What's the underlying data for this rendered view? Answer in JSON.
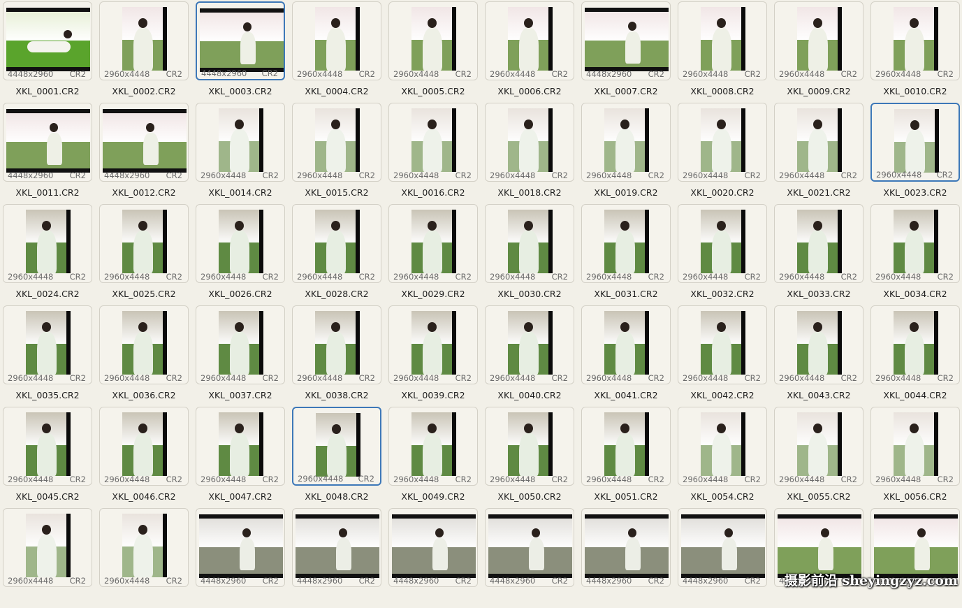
{
  "thumbnails": [
    {
      "name": "XKL_0001.CR2",
      "dims": "4448x2960",
      "format": "CR2",
      "orientation": "landscape",
      "scene": "grass",
      "selected": false
    },
    {
      "name": "XKL_0002.CR2",
      "dims": "2960x4448",
      "format": "CR2",
      "orientation": "portrait",
      "scene": "blossom",
      "selected": false
    },
    {
      "name": "XKL_0003.CR2",
      "dims": "4448x2960",
      "format": "CR2",
      "orientation": "landscape",
      "scene": "blossom",
      "selected": true
    },
    {
      "name": "XKL_0004.CR2",
      "dims": "2960x4448",
      "format": "CR2",
      "orientation": "portrait",
      "scene": "blossom",
      "selected": false
    },
    {
      "name": "XKL_0005.CR2",
      "dims": "2960x4448",
      "format": "CR2",
      "orientation": "portrait",
      "scene": "blossom",
      "selected": false
    },
    {
      "name": "XKL_0006.CR2",
      "dims": "2960x4448",
      "format": "CR2",
      "orientation": "portrait",
      "scene": "blossom",
      "selected": false
    },
    {
      "name": "XKL_0007.CR2",
      "dims": "4448x2960",
      "format": "CR2",
      "orientation": "landscape",
      "scene": "blossom",
      "selected": false
    },
    {
      "name": "XKL_0008.CR2",
      "dims": "2960x4448",
      "format": "CR2",
      "orientation": "portrait",
      "scene": "blossom",
      "selected": false
    },
    {
      "name": "XKL_0009.CR2",
      "dims": "2960x4448",
      "format": "CR2",
      "orientation": "portrait",
      "scene": "blossom",
      "selected": false
    },
    {
      "name": "XKL_0010.CR2",
      "dims": "2960x4448",
      "format": "CR2",
      "orientation": "portrait",
      "scene": "blossom",
      "selected": false
    },
    {
      "name": "XKL_0011.CR2",
      "dims": "4448x2960",
      "format": "CR2",
      "orientation": "landscape",
      "scene": "blossom",
      "selected": false
    },
    {
      "name": "XKL_0012.CR2",
      "dims": "4448x2960",
      "format": "CR2",
      "orientation": "landscape",
      "scene": "blossom",
      "selected": false
    },
    {
      "name": "XKL_0014.CR2",
      "dims": "2960x4448",
      "format": "CR2",
      "orientation": "portrait",
      "scene": "soft",
      "selected": false
    },
    {
      "name": "XKL_0015.CR2",
      "dims": "2960x4448",
      "format": "CR2",
      "orientation": "portrait",
      "scene": "soft",
      "selected": false
    },
    {
      "name": "XKL_0016.CR2",
      "dims": "2960x4448",
      "format": "CR2",
      "orientation": "portrait",
      "scene": "soft",
      "selected": false
    },
    {
      "name": "XKL_0018.CR2",
      "dims": "2960x4448",
      "format": "CR2",
      "orientation": "portrait",
      "scene": "soft",
      "selected": false
    },
    {
      "name": "XKL_0019.CR2",
      "dims": "2960x4448",
      "format": "CR2",
      "orientation": "portrait",
      "scene": "soft",
      "selected": false
    },
    {
      "name": "XKL_0020.CR2",
      "dims": "2960x4448",
      "format": "CR2",
      "orientation": "portrait",
      "scene": "soft",
      "selected": false
    },
    {
      "name": "XKL_0021.CR2",
      "dims": "2960x4448",
      "format": "CR2",
      "orientation": "portrait",
      "scene": "soft",
      "selected": false
    },
    {
      "name": "XKL_0023.CR2",
      "dims": "2960x4448",
      "format": "CR2",
      "orientation": "portrait",
      "scene": "soft",
      "selected": true
    },
    {
      "name": "XKL_0024.CR2",
      "dims": "2960x4448",
      "format": "CR2",
      "orientation": "portrait",
      "scene": "park",
      "selected": false
    },
    {
      "name": "XKL_0025.CR2",
      "dims": "2960x4448",
      "format": "CR2",
      "orientation": "portrait",
      "scene": "park",
      "selected": false
    },
    {
      "name": "XKL_0026.CR2",
      "dims": "2960x4448",
      "format": "CR2",
      "orientation": "portrait",
      "scene": "park",
      "selected": false
    },
    {
      "name": "XKL_0028.CR2",
      "dims": "2960x4448",
      "format": "CR2",
      "orientation": "portrait",
      "scene": "park",
      "selected": false
    },
    {
      "name": "XKL_0029.CR2",
      "dims": "2960x4448",
      "format": "CR2",
      "orientation": "portrait",
      "scene": "park",
      "selected": false
    },
    {
      "name": "XKL_0030.CR2",
      "dims": "2960x4448",
      "format": "CR2",
      "orientation": "portrait",
      "scene": "park",
      "selected": false
    },
    {
      "name": "XKL_0031.CR2",
      "dims": "2960x4448",
      "format": "CR2",
      "orientation": "portrait",
      "scene": "park",
      "selected": false
    },
    {
      "name": "XKL_0032.CR2",
      "dims": "2960x4448",
      "format": "CR2",
      "orientation": "portrait",
      "scene": "park",
      "selected": false
    },
    {
      "name": "XKL_0033.CR2",
      "dims": "2960x4448",
      "format": "CR2",
      "orientation": "portrait",
      "scene": "park",
      "selected": false
    },
    {
      "name": "XKL_0034.CR2",
      "dims": "2960x4448",
      "format": "CR2",
      "orientation": "portrait",
      "scene": "park",
      "selected": false
    },
    {
      "name": "XKL_0035.CR2",
      "dims": "2960x4448",
      "format": "CR2",
      "orientation": "portrait",
      "scene": "park",
      "selected": false
    },
    {
      "name": "XKL_0036.CR2",
      "dims": "2960x4448",
      "format": "CR2",
      "orientation": "portrait",
      "scene": "park",
      "selected": false
    },
    {
      "name": "XKL_0037.CR2",
      "dims": "2960x4448",
      "format": "CR2",
      "orientation": "portrait",
      "scene": "park",
      "selected": false
    },
    {
      "name": "XKL_0038.CR2",
      "dims": "2960x4448",
      "format": "CR2",
      "orientation": "portrait",
      "scene": "park",
      "selected": false
    },
    {
      "name": "XKL_0039.CR2",
      "dims": "2960x4448",
      "format": "CR2",
      "orientation": "portrait",
      "scene": "park",
      "selected": false
    },
    {
      "name": "XKL_0040.CR2",
      "dims": "2960x4448",
      "format": "CR2",
      "orientation": "portrait",
      "scene": "park",
      "selected": false
    },
    {
      "name": "XKL_0041.CR2",
      "dims": "2960x4448",
      "format": "CR2",
      "orientation": "portrait",
      "scene": "park",
      "selected": false
    },
    {
      "name": "XKL_0042.CR2",
      "dims": "2960x4448",
      "format": "CR2",
      "orientation": "portrait",
      "scene": "park",
      "selected": false
    },
    {
      "name": "XKL_0043.CR2",
      "dims": "2960x4448",
      "format": "CR2",
      "orientation": "portrait",
      "scene": "park",
      "selected": false
    },
    {
      "name": "XKL_0044.CR2",
      "dims": "2960x4448",
      "format": "CR2",
      "orientation": "portrait",
      "scene": "park",
      "selected": false
    },
    {
      "name": "XKL_0045.CR2",
      "dims": "2960x4448",
      "format": "CR2",
      "orientation": "portrait",
      "scene": "park",
      "selected": false
    },
    {
      "name": "XKL_0046.CR2",
      "dims": "2960x4448",
      "format": "CR2",
      "orientation": "portrait",
      "scene": "park",
      "selected": false
    },
    {
      "name": "XKL_0047.CR2",
      "dims": "2960x4448",
      "format": "CR2",
      "orientation": "portrait",
      "scene": "park",
      "selected": false
    },
    {
      "name": "XKL_0048.CR2",
      "dims": "2960x4448",
      "format": "CR2",
      "orientation": "portrait",
      "scene": "park",
      "selected": true
    },
    {
      "name": "XKL_0049.CR2",
      "dims": "2960x4448",
      "format": "CR2",
      "orientation": "portrait",
      "scene": "park",
      "selected": false
    },
    {
      "name": "XKL_0050.CR2",
      "dims": "2960x4448",
      "format": "CR2",
      "orientation": "portrait",
      "scene": "park",
      "selected": false
    },
    {
      "name": "XKL_0051.CR2",
      "dims": "2960x4448",
      "format": "CR2",
      "orientation": "portrait",
      "scene": "park",
      "selected": false
    },
    {
      "name": "XKL_0054.CR2",
      "dims": "2960x4448",
      "format": "CR2",
      "orientation": "portrait",
      "scene": "soft",
      "selected": false
    },
    {
      "name": "XKL_0055.CR2",
      "dims": "2960x4448",
      "format": "CR2",
      "orientation": "portrait",
      "scene": "soft",
      "selected": false
    },
    {
      "name": "XKL_0056.CR2",
      "dims": "2960x4448",
      "format": "CR2",
      "orientation": "portrait",
      "scene": "soft",
      "selected": false
    },
    {
      "name": "",
      "dims": "2960x4448",
      "format": "CR2",
      "orientation": "portrait",
      "scene": "soft",
      "selected": false
    },
    {
      "name": "",
      "dims": "2960x4448",
      "format": "CR2",
      "orientation": "portrait",
      "scene": "soft",
      "selected": false
    },
    {
      "name": "",
      "dims": "4448x2960",
      "format": "CR2",
      "orientation": "landscape",
      "scene": "path",
      "selected": false
    },
    {
      "name": "",
      "dims": "4448x2960",
      "format": "CR2",
      "orientation": "landscape",
      "scene": "path",
      "selected": false
    },
    {
      "name": "",
      "dims": "4448x2960",
      "format": "CR2",
      "orientation": "landscape",
      "scene": "path",
      "selected": false
    },
    {
      "name": "",
      "dims": "4448x2960",
      "format": "CR2",
      "orientation": "landscape",
      "scene": "path",
      "selected": false
    },
    {
      "name": "",
      "dims": "4448x2960",
      "format": "CR2",
      "orientation": "landscape",
      "scene": "path",
      "selected": false
    },
    {
      "name": "",
      "dims": "4448x2960",
      "format": "CR2",
      "orientation": "landscape",
      "scene": "path",
      "selected": false
    },
    {
      "name": "",
      "dims": "4448x2960",
      "format": "CR2",
      "orientation": "landscape",
      "scene": "blossom",
      "selected": false
    },
    {
      "name": "",
      "dims": "4448x2960",
      "format": "CR2",
      "orientation": "landscape",
      "scene": "blossom",
      "selected": false
    }
  ],
  "watermark": {
    "text": "摄影前沿 sheyingzyz.com"
  },
  "colors": {
    "background": "#f2f0e8",
    "selection_border": "#3d78b8",
    "card_border": "#d3d0c6"
  }
}
